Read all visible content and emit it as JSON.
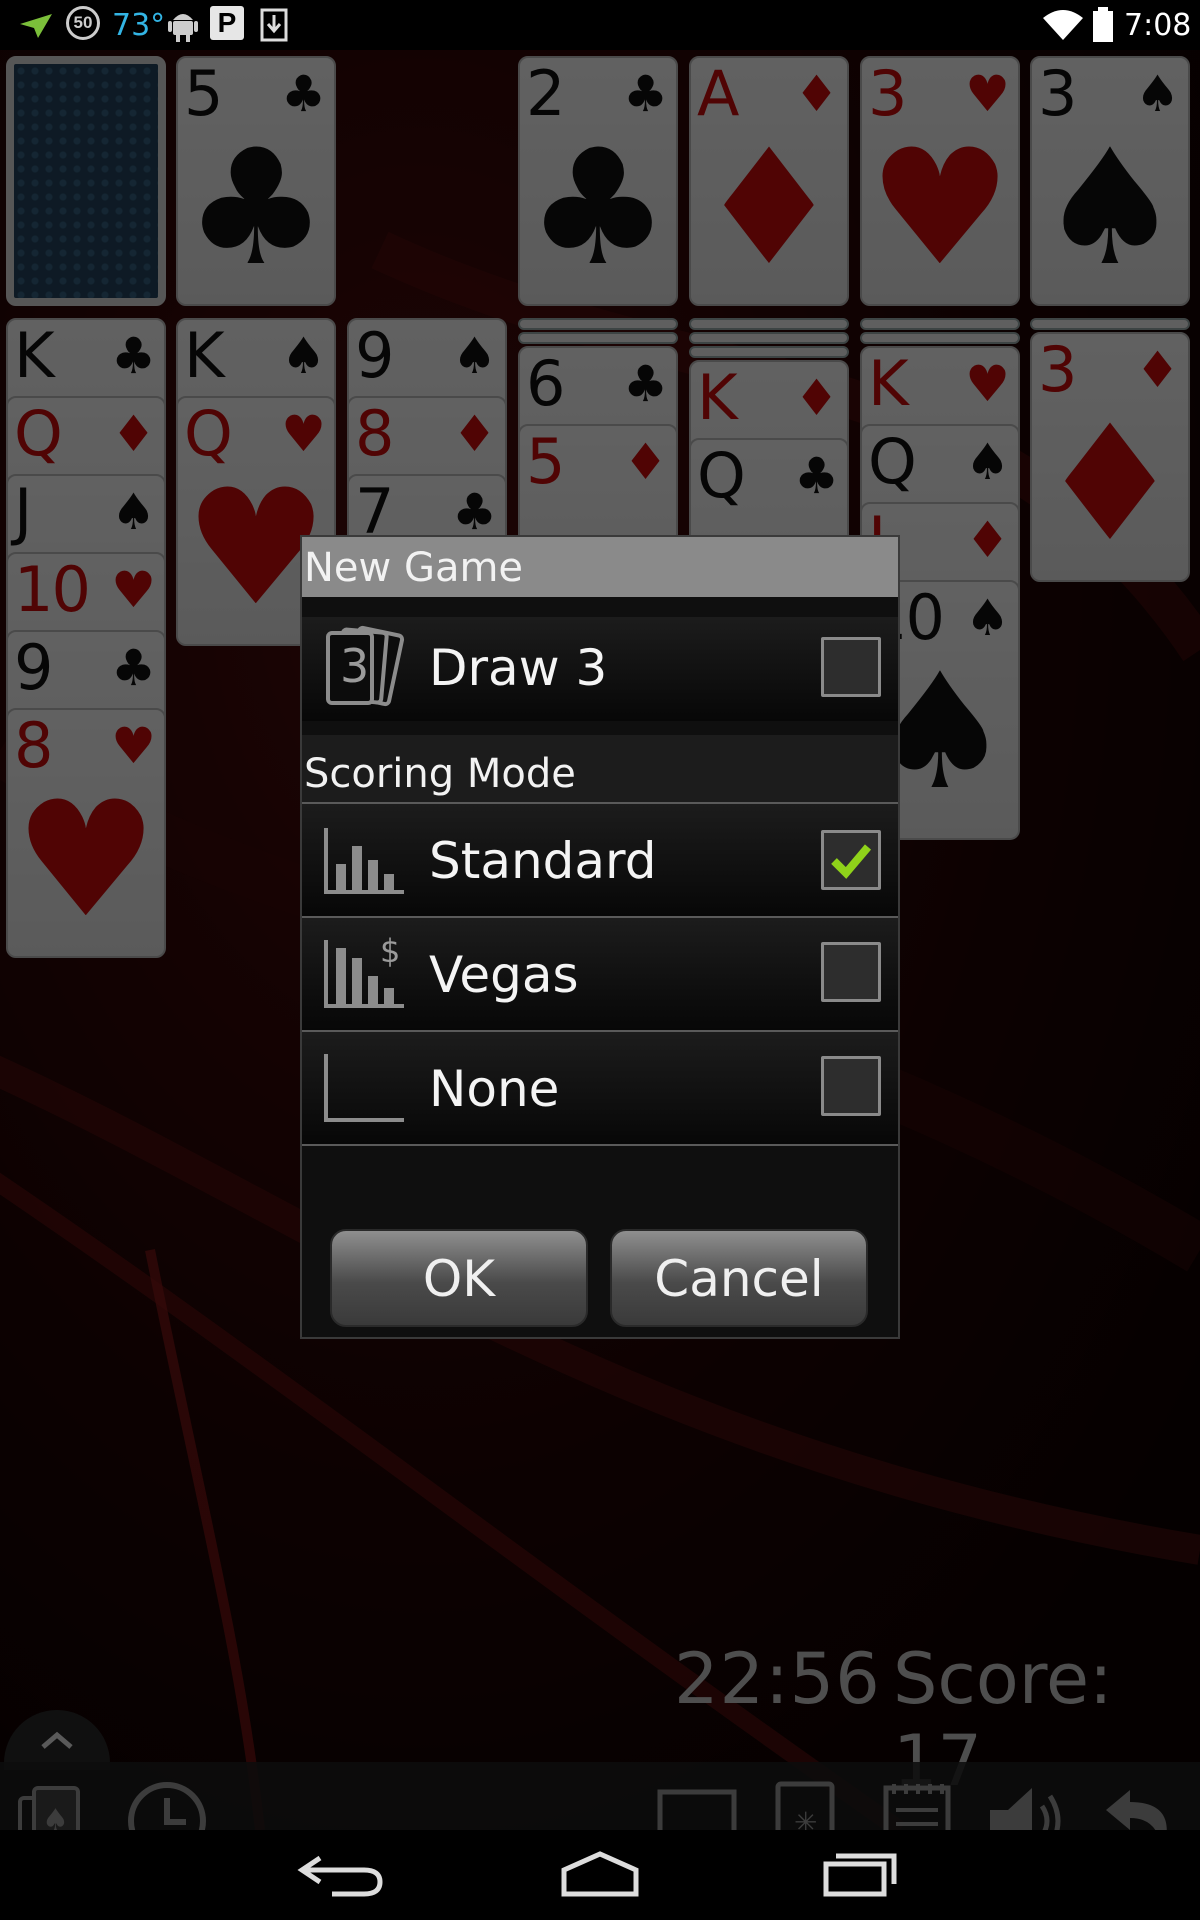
{
  "status_bar": {
    "notification_number": "50",
    "temperature": "73°",
    "parking_letter": "P",
    "time": "7:08",
    "icons": [
      "plane-icon",
      "battery-saver-icon",
      "android-icon",
      "parking-icon",
      "download-icon",
      "wifi-icon",
      "battery-icon"
    ]
  },
  "game": {
    "stock": {
      "face_down": true
    },
    "waste": {
      "rank": "5",
      "suit": "♣",
      "color": "black"
    },
    "foundations": [
      {
        "rank": "2",
        "suit": "♣",
        "color": "black"
      },
      {
        "rank": "A",
        "suit": "♦",
        "color": "red"
      },
      {
        "rank": "3",
        "suit": "♥",
        "color": "red"
      },
      {
        "rank": "3",
        "suit": "♠",
        "color": "black"
      }
    ],
    "tableau": [
      {
        "cards": [
          {
            "rank": "K",
            "suit": "♣",
            "color": "black"
          },
          {
            "rank": "Q",
            "suit": "♦",
            "color": "red"
          },
          {
            "rank": "J",
            "suit": "♠",
            "color": "black"
          },
          {
            "rank": "10",
            "suit": "♥",
            "color": "red"
          },
          {
            "rank": "9",
            "suit": "♣",
            "color": "black"
          },
          {
            "rank": "8",
            "suit": "♥",
            "color": "red"
          }
        ]
      },
      {
        "cards": [
          {
            "rank": "K",
            "suit": "♠",
            "color": "black"
          },
          {
            "rank": "Q",
            "suit": "♥",
            "color": "red"
          }
        ]
      },
      {
        "cards": [
          {
            "rank": "9",
            "suit": "♠",
            "color": "black"
          },
          {
            "rank": "8",
            "suit": "♦",
            "color": "red"
          },
          {
            "rank": "7",
            "suit": "♣",
            "color": "black"
          }
        ]
      },
      {
        "cards": [
          {
            "rank": "6",
            "suit": "♣",
            "color": "black"
          },
          {
            "rank": "5",
            "suit": "♦",
            "color": "red"
          }
        ]
      },
      {
        "cards": [
          {
            "rank": "K",
            "suit": "♦",
            "color": "red"
          },
          {
            "rank": "Q",
            "suit": "♣",
            "color": "black"
          }
        ]
      },
      {
        "cards": [
          {
            "rank": "K",
            "suit": "♥",
            "color": "red"
          },
          {
            "rank": "Q",
            "suit": "♠",
            "color": "black"
          },
          {
            "rank": "J",
            "suit": "♦",
            "color": "red"
          },
          {
            "rank": "10",
            "suit": "♠",
            "color": "black"
          }
        ]
      },
      {
        "cards": [
          {
            "rank": "3",
            "suit": "♦",
            "color": "red"
          }
        ]
      }
    ],
    "timer": "22:56",
    "score_label": "Score: 17",
    "toolbar_icons": [
      "deal-cards-icon",
      "clock-icon",
      "display-icon",
      "card-back-icon",
      "notepad-icon",
      "sound-icon",
      "undo-icon"
    ]
  },
  "dialog": {
    "title": "New Game",
    "draw_option": {
      "label": "Draw 3",
      "icon_text": "3",
      "checked": false
    },
    "scoring_header": "Scoring Mode",
    "scoring_options": [
      {
        "label": "Standard",
        "checked": true
      },
      {
        "label": "Vegas",
        "checked": false
      },
      {
        "label": "None",
        "checked": false
      }
    ],
    "vegas_icon_text": "$",
    "ok_label": "OK",
    "cancel_label": "Cancel"
  },
  "colors": {
    "accent_blue": "#33b5e5",
    "check_green": "#8fd21a",
    "card_red": "#c80a0a",
    "background_red": "#4a0c0c"
  },
  "nav_icons": [
    "back-icon",
    "home-icon",
    "recents-icon"
  ]
}
